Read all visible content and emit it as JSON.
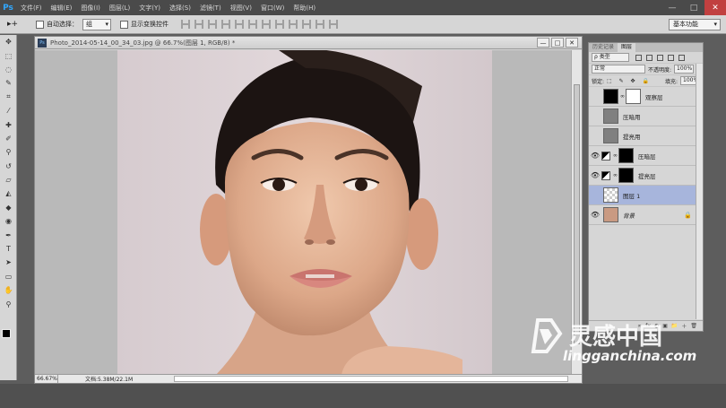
{
  "app": {
    "logo": "Ps"
  },
  "menu": [
    "文件(F)",
    "编辑(E)",
    "图像(I)",
    "图层(L)",
    "文字(Y)",
    "选择(S)",
    "滤镜(T)",
    "视图(V)",
    "窗口(W)",
    "帮助(H)"
  ],
  "window_buttons": {
    "minimize": "—",
    "restore": "□",
    "close": "✕"
  },
  "options": {
    "auto_select_label": "自动选择：",
    "auto_select_value": "组",
    "show_transform_label": "显示变换控件",
    "workspace": "基本功能"
  },
  "document": {
    "title": "Photo_2014-05-14_00_34_03.jpg @ 66.7%(图层 1, RGB/8) *",
    "zoom": "66.67%",
    "doc_size": "文档:5.38M/22.1M",
    "btn_min": "—",
    "btn_max": "□",
    "btn_close": "✕"
  },
  "layers_panel": {
    "tabs": [
      "历史记录",
      "图层"
    ],
    "filter_kind": "ρ 类型",
    "blend_mode": "正常",
    "opacity_label": "不透明度:",
    "opacity_value": "100%",
    "lock_label": "锁定:",
    "fill_label": "填充:",
    "fill_value": "100%",
    "layers": [
      {
        "name": "观察层",
        "visible": false
      },
      {
        "name": "压暗用",
        "visible": false
      },
      {
        "name": "提亮用",
        "visible": false
      },
      {
        "name": "压暗层",
        "visible": true
      },
      {
        "name": "提亮层",
        "visible": true
      },
      {
        "name": "图层 1",
        "visible": false,
        "selected": true
      },
      {
        "name": "背景",
        "visible": true,
        "locked": true
      }
    ],
    "footer_icons": [
      "∞",
      "fx",
      "◐",
      "▣",
      "📁",
      "＋",
      "🗑"
    ]
  },
  "watermark": {
    "text": "lingganchina.com"
  },
  "colors": {
    "accent": "#31a8ff",
    "selected_layer": "#a7b5dc"
  }
}
